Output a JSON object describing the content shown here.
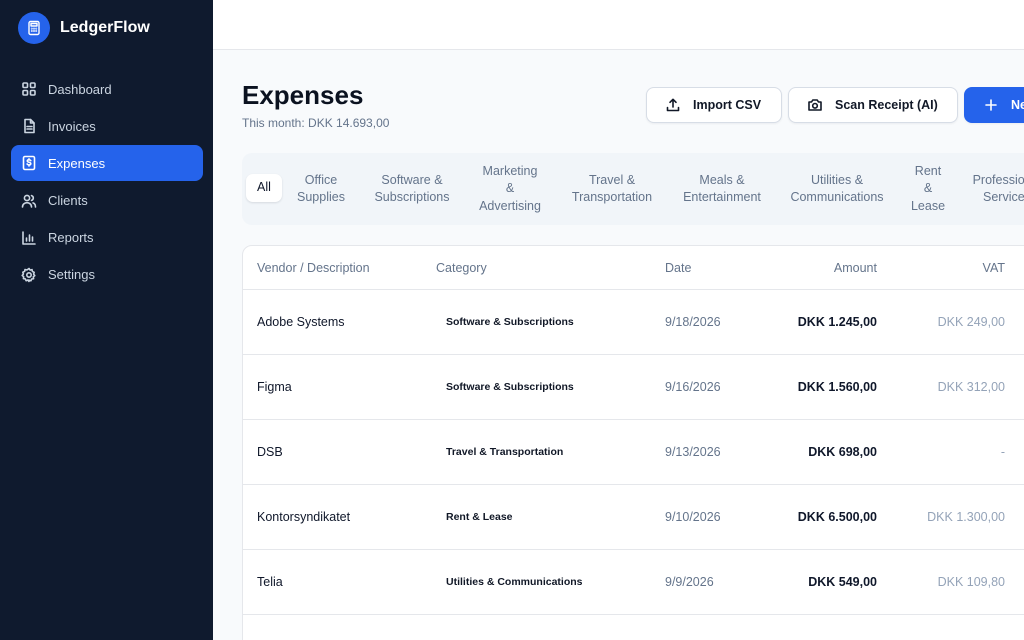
{
  "app": {
    "name": "LedgerFlow"
  },
  "sidebar": {
    "items": [
      {
        "label": "Dashboard",
        "icon": "dashboard-icon"
      },
      {
        "label": "Invoices",
        "icon": "file-icon"
      },
      {
        "label": "Expenses",
        "icon": "receipt-icon",
        "active": true
      },
      {
        "label": "Clients",
        "icon": "users-icon"
      },
      {
        "label": "Reports",
        "icon": "bar-chart-icon"
      },
      {
        "label": "Settings",
        "icon": "gear-icon"
      }
    ]
  },
  "header": {
    "title": "Expenses",
    "subtitle": "This month: DKK 14.693,00"
  },
  "actions": {
    "import_label": "Import CSV",
    "scan_label": "Scan Receipt (AI)",
    "new_label": "New Expense"
  },
  "filters": [
    {
      "label": "All",
      "active": true
    },
    {
      "label": "Office\nSupplies"
    },
    {
      "label": "Software &\nSubscriptions"
    },
    {
      "label": "Marketing\n&\nAdvertising"
    },
    {
      "label": "Travel &\nTransportation"
    },
    {
      "label": "Meals &\nEntertainment"
    },
    {
      "label": "Utilities &\nCommunications"
    },
    {
      "label": "Rent\n&\nLease"
    },
    {
      "label": "Professional\nServices"
    }
  ],
  "table": {
    "columns": [
      "Vendor / Description",
      "Category",
      "Date",
      "Amount",
      "VAT"
    ],
    "rows": [
      {
        "vendor": "Adobe Systems",
        "category": "Software & Subscriptions",
        "date": "9/18/2026",
        "amount": "DKK 1.245,00",
        "vat": "DKK 249,00"
      },
      {
        "vendor": "Figma",
        "category": "Software & Subscriptions",
        "date": "9/16/2026",
        "amount": "DKK 1.560,00",
        "vat": "DKK 312,00"
      },
      {
        "vendor": "DSB",
        "category": "Travel & Transportation",
        "date": "9/13/2026",
        "amount": "DKK 698,00",
        "vat": "-"
      },
      {
        "vendor": "Kontorsyndikatet",
        "category": "Rent & Lease",
        "date": "9/10/2026",
        "amount": "DKK 6.500,00",
        "vat": "DKK 1.300,00"
      },
      {
        "vendor": "Telia",
        "category": "Utilities & Communications",
        "date": "9/9/2026",
        "amount": "DKK 549,00",
        "vat": "DKK 109,80"
      }
    ]
  },
  "colors": {
    "sidebar_bg": "#0f1a2e",
    "accent": "#2563eb",
    "page_bg": "#f8fafc"
  }
}
